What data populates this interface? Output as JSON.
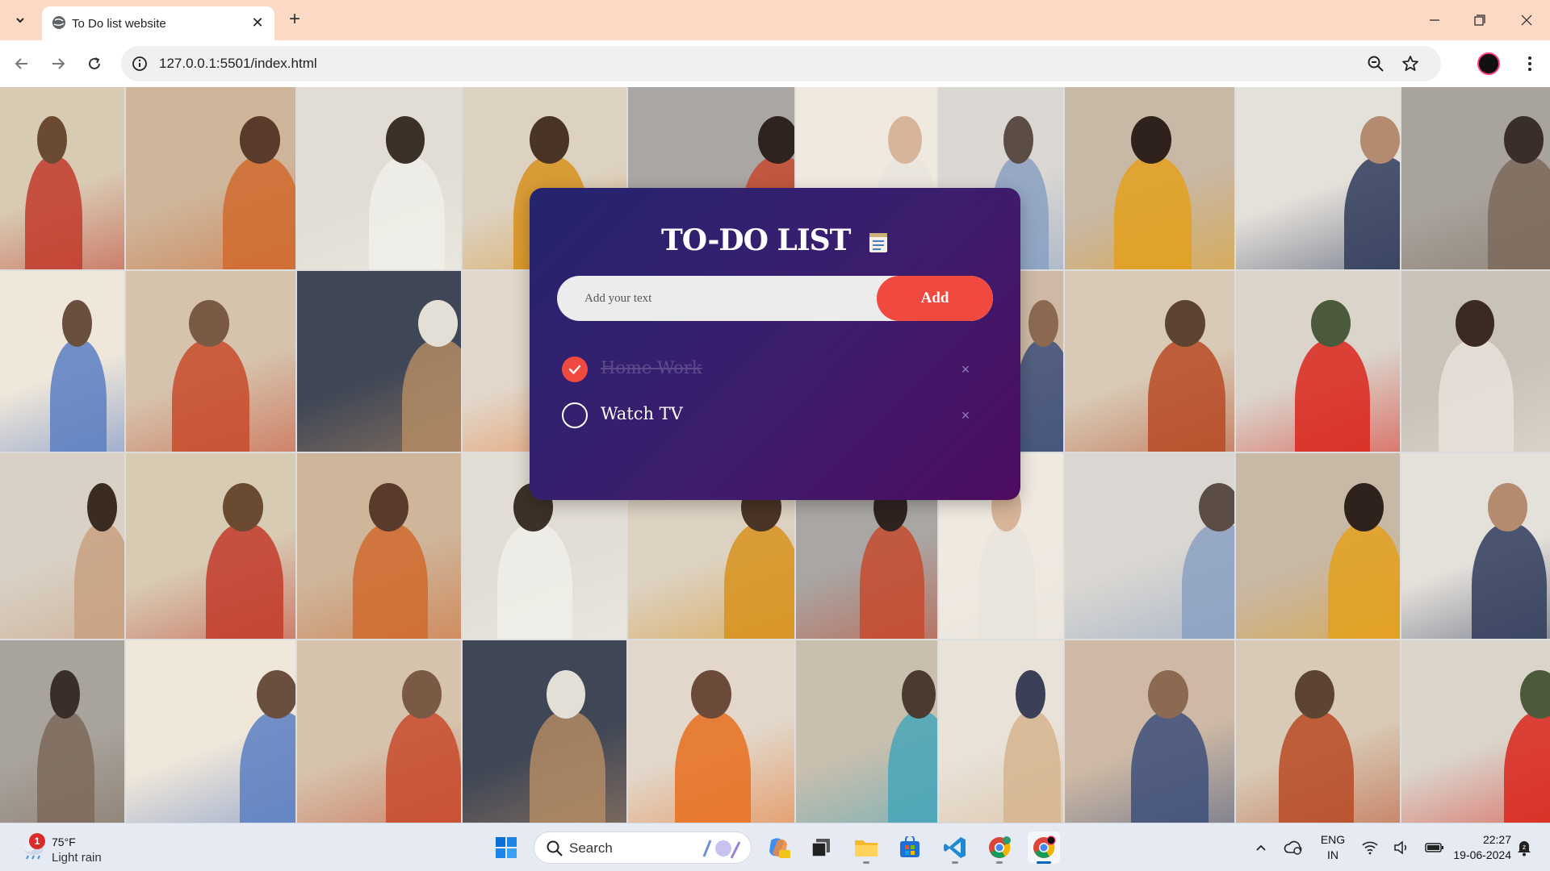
{
  "browser": {
    "tab_title": "To Do list website",
    "url": "127.0.0.1:5501/index.html"
  },
  "todo": {
    "title": "TO-DO LIST",
    "input_placeholder": "Add your text",
    "add_label": "Add",
    "tasks": [
      {
        "text": "Home Work",
        "done": true
      },
      {
        "text": "Watch TV",
        "done": false
      }
    ],
    "remove_glyph": "×",
    "accent_color": "#f0493f"
  },
  "taskbar": {
    "weather_badge": "1",
    "weather_temp": "75°F",
    "weather_condition": "Light rain",
    "search_label": "Search",
    "language": "ENG",
    "region": "IN",
    "time": "22:27",
    "date": "19-06-2024"
  }
}
